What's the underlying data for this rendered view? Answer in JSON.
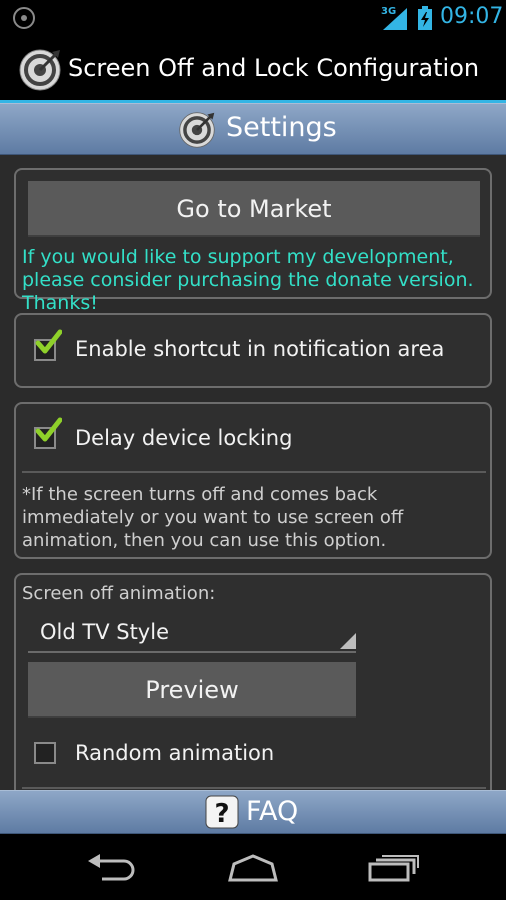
{
  "status_bar": {
    "network": "3G",
    "time": "09:07",
    "icons": [
      "notification-target-icon",
      "signal-icon",
      "battery-charging-icon"
    ]
  },
  "action_bar": {
    "title": "Screen Off and Lock Configuration",
    "icon": "target-app-icon"
  },
  "settings_bar": {
    "label": "Settings",
    "icon": "target-app-icon"
  },
  "market_card": {
    "button_label": "Go to Market",
    "support_text": "If you would like to support my development, please consider purchasing the donate version. Thanks!"
  },
  "shortcut_card": {
    "label": "Enable shortcut in notification area",
    "checked": true
  },
  "delay_card": {
    "label": "Delay device locking",
    "checked": true,
    "note": "*If the screen turns off and comes back immediately or you want to use screen off animation, then you can use this option."
  },
  "animation_card": {
    "section_label": "Screen off animation:",
    "selected_animation": "Old TV Style",
    "preview_label": "Preview",
    "random_label": "Random animation",
    "random_checked": false
  },
  "faq_bar": {
    "label": "FAQ",
    "icon": "question-icon"
  },
  "nav_bar": {
    "icons": [
      "back-icon",
      "home-icon",
      "recent-apps-icon"
    ]
  },
  "colors": {
    "accent": "#33b5e5",
    "support_text": "#33e0c8",
    "checkmark": "#8fd12a",
    "bar_gradient_top": "#8ea7c7",
    "bar_gradient_bottom": "#5e7ba3"
  }
}
